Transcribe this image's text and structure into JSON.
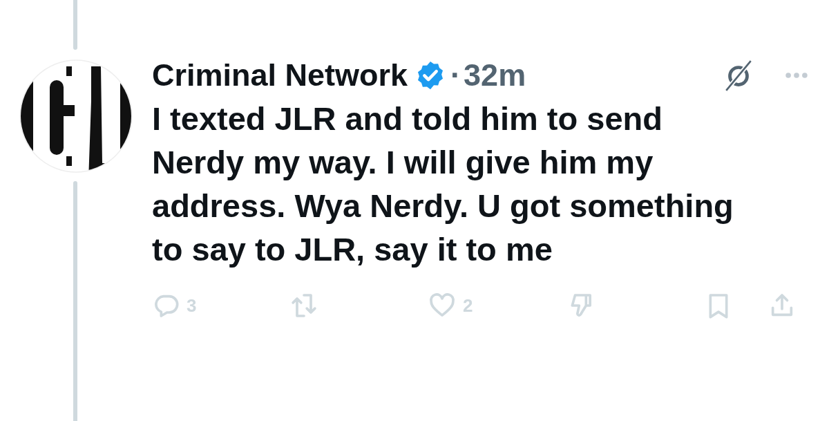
{
  "post": {
    "author": "Criminal Network",
    "verified": true,
    "separator": "·",
    "time": "32m",
    "text": "I texted JLR and told him to send Nerdy my way. I will give him my address. Wya Nerdy. U got something to say to JLR, say it to me",
    "actions": [
      {
        "kind": "reply",
        "count": "3"
      },
      {
        "kind": "repost"
      },
      {
        "kind": "like",
        "count": "2"
      },
      {
        "kind": "dislike"
      },
      {
        "kind": "bookmark"
      },
      {
        "kind": "share"
      }
    ]
  }
}
